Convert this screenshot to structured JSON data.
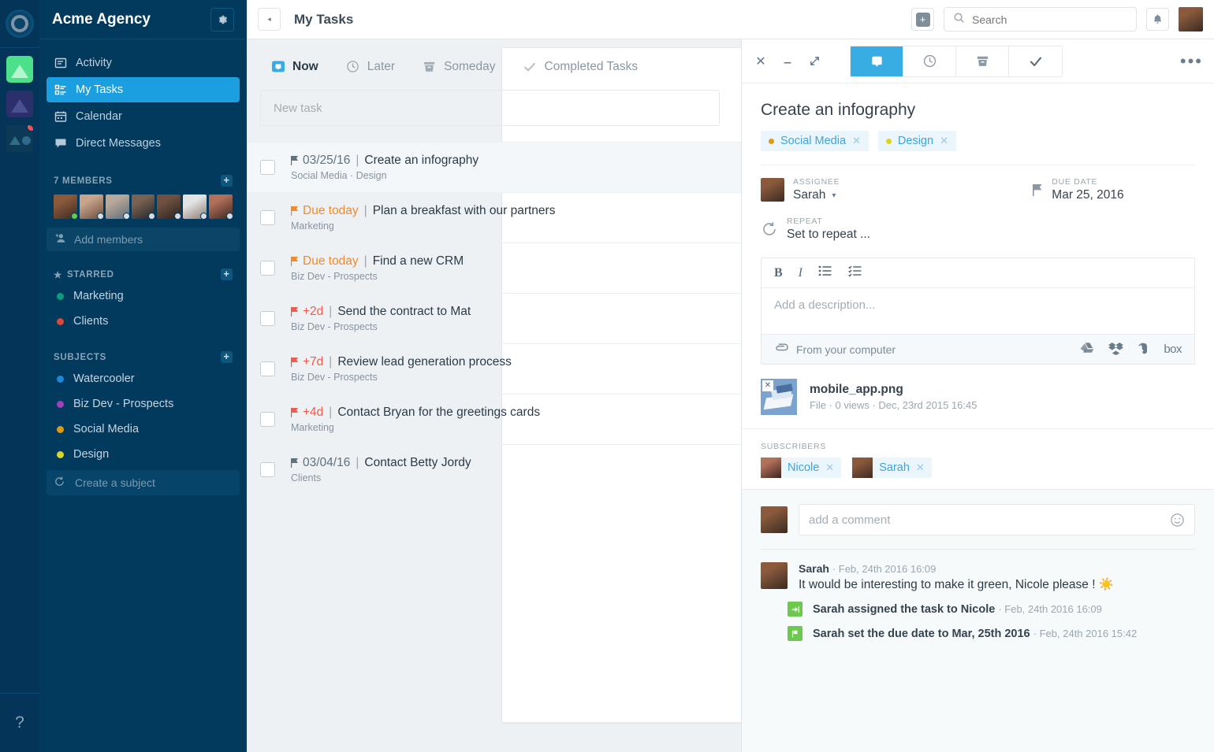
{
  "rail": {
    "logo": "app-logo",
    "workspaces": [
      {
        "name": "workspace-green",
        "color": "#4ce08a",
        "badge": false
      },
      {
        "name": "workspace-navy",
        "color": "#2b2f6b",
        "badge": false
      },
      {
        "name": "workspace-dark",
        "color": "#0c3a56",
        "badge": true
      }
    ],
    "help_label": "?"
  },
  "sidebar": {
    "title": "Acme Agency",
    "gear_label": "⚙",
    "nav": [
      {
        "label": "Activity",
        "icon": "activity-icon",
        "active": false
      },
      {
        "label": "My Tasks",
        "icon": "tasks-icon",
        "active": true
      },
      {
        "label": "Calendar",
        "icon": "calendar-icon",
        "active": false
      },
      {
        "label": "Direct Messages",
        "icon": "messages-icon",
        "active": false
      }
    ],
    "members_header": "7 MEMBERS",
    "add_members_label": "Add members",
    "starred_header": "STARRED",
    "starred": [
      {
        "label": "Marketing",
        "color": "#0f9b7e"
      },
      {
        "label": "Clients",
        "color": "#d9483b"
      }
    ],
    "subjects_header": "SUBJECTS",
    "subjects": [
      {
        "label": "Watercooler",
        "color": "#1f87d8"
      },
      {
        "label": "Biz Dev - Prospects",
        "color": "#a23fba"
      },
      {
        "label": "Social Media",
        "color": "#e09a12"
      },
      {
        "label": "Design",
        "color": "#d8d528"
      }
    ],
    "create_subject_label": "Create a subject"
  },
  "topbar": {
    "title": "My Tasks",
    "collapse_label": "◂",
    "plus_label": "+",
    "search_placeholder": "Search",
    "bell_label": "notifications"
  },
  "list": {
    "tabs": [
      {
        "label": "Now",
        "icon": "now-icon",
        "active": true
      },
      {
        "label": "Later",
        "icon": "clock-icon",
        "active": false
      },
      {
        "label": "Someday",
        "icon": "archive-icon",
        "active": false
      },
      {
        "label": "Completed Tasks",
        "icon": "check-icon",
        "active": false
      }
    ],
    "new_task_placeholder": "New task",
    "tasks": [
      {
        "due": "03/25/16",
        "due_style": "gray",
        "title": "Create an infography",
        "subject": "Social Media · Design",
        "selected": true
      },
      {
        "due": "Due today",
        "due_style": "orange",
        "title": "Plan a breakfast with our partners",
        "subject": "Marketing",
        "selected": false
      },
      {
        "due": "Due today",
        "due_style": "orange",
        "title": "Find a new CRM",
        "subject": "Biz Dev - Prospects",
        "selected": false
      },
      {
        "due": "+2d",
        "due_style": "red",
        "title": "Send the contract to Mat",
        "subject": "Biz Dev - Prospects",
        "selected": false
      },
      {
        "due": "+7d",
        "due_style": "red",
        "title": "Review lead generation process",
        "subject": "Biz Dev - Prospects",
        "selected": false
      },
      {
        "due": "+4d",
        "due_style": "red",
        "title": "Contact Bryan for the greetings cards",
        "subject": "Marketing",
        "selected": false
      },
      {
        "due": "03/04/16",
        "due_style": "gray",
        "title": "Contact Betty Jordy",
        "subject": "Clients",
        "selected": false
      }
    ]
  },
  "detail": {
    "window_buttons": [
      {
        "name": "close-icon",
        "label": "✕"
      },
      {
        "name": "minimize-icon",
        "label": "—"
      },
      {
        "name": "expand-icon",
        "label": "↗"
      }
    ],
    "tabs": [
      {
        "name": "task-tab",
        "icon": "now-icon",
        "active": true
      },
      {
        "name": "later-tab",
        "icon": "clock-icon",
        "active": false
      },
      {
        "name": "someday-tab",
        "icon": "archive-icon",
        "active": false
      },
      {
        "name": "complete-tab",
        "icon": "check-icon",
        "active": false
      }
    ],
    "more_label": "•••",
    "title": "Create an infography",
    "chips": [
      {
        "label": "Social Media",
        "color": "#e09a12",
        "close": "✕"
      },
      {
        "label": "Design",
        "color": "#d8d528",
        "close": "✕"
      }
    ],
    "assignee_label": "ASSIGNEE",
    "assignee_value": "Sarah",
    "due_label": "DUE DATE",
    "due_value": "Mar 25, 2016",
    "repeat_label": "REPEAT",
    "repeat_value": "Set to repeat ...",
    "editor": {
      "bold": "B",
      "italic": "I",
      "bullet_list": "bullet-list-icon",
      "check_list": "check-list-icon",
      "placeholder": "Add a description...",
      "upload_label": "From your computer",
      "clouds": [
        "google-drive-icon",
        "dropbox-icon",
        "evernote-icon",
        "box-icon"
      ],
      "box_label": "box"
    },
    "file": {
      "name": "mobile_app.png",
      "meta": "File · 0 views · Dec, 23rd 2015 16:45",
      "remove": "✕"
    },
    "subscribers_label": "SUBSCRIBERS",
    "subscribers": [
      {
        "name": "Nicole",
        "close": "✕"
      },
      {
        "name": "Sarah",
        "close": "✕"
      }
    ],
    "comment_placeholder": "add a comment",
    "feed": [
      {
        "type": "comment",
        "author": "Sarah",
        "time": "Feb, 24th 2016 16:09",
        "text": "It would be interesting to make it green, Nicole please ! ☀️"
      },
      {
        "type": "event",
        "icon": "assign-icon",
        "actor": "Sarah",
        "text": "assigned the task to Nicole",
        "time": "Feb, 24th 2016 16:09"
      },
      {
        "type": "event",
        "icon": "flag-icon",
        "actor": "Sarah",
        "text": "set the due date to Mar, 25th 2016",
        "time": "Feb, 24th 2016 15:42"
      }
    ]
  },
  "colors": {
    "accent": "#38ade3",
    "sidebar_bg": "#023a5e",
    "rail_bg": "#043558",
    "due_orange": "#f0892b",
    "due_red": "#f05b4d",
    "event_green": "#6dc84f"
  }
}
